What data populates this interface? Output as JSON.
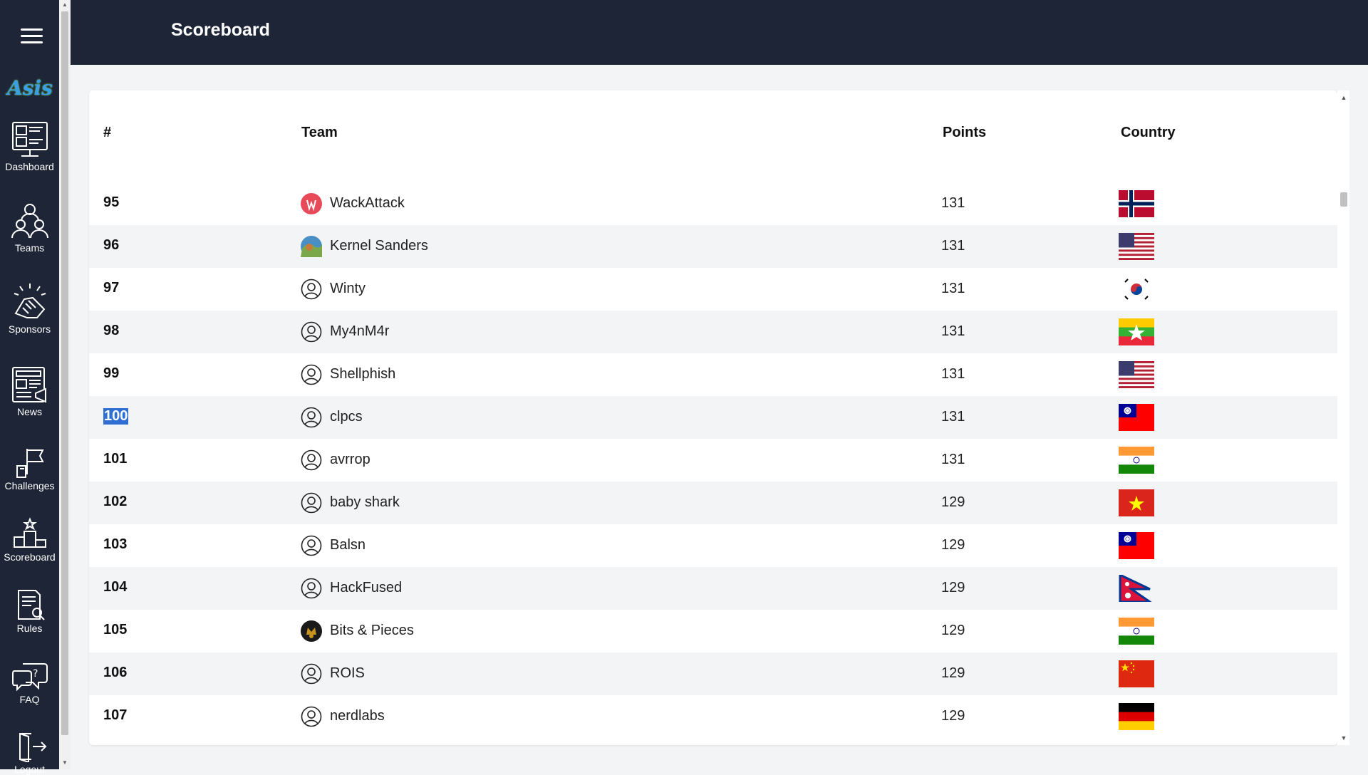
{
  "header": {
    "title": "Scoreboard"
  },
  "sidebar": {
    "logo": "Asis",
    "items": [
      {
        "label": "Dashboard"
      },
      {
        "label": "Teams"
      },
      {
        "label": "Sponsors"
      },
      {
        "label": "News"
      },
      {
        "label": "Challenges"
      },
      {
        "label": "Scoreboard"
      },
      {
        "label": "Rules"
      },
      {
        "label": "FAQ"
      },
      {
        "label": "Logout"
      }
    ]
  },
  "table": {
    "columns": {
      "rank": "#",
      "team": "Team",
      "points": "Points",
      "country": "Country"
    },
    "rows": [
      {
        "rank": "95",
        "team": "WackAttack",
        "points": "131",
        "country": "Norway",
        "avatar": "wackattack-logo"
      },
      {
        "rank": "96",
        "team": "Kernel Sanders",
        "points": "131",
        "country": "United States",
        "avatar": "kernel-sanders-logo"
      },
      {
        "rank": "97",
        "team": "Winty",
        "points": "131",
        "country": "South Korea",
        "avatar": "user-icon"
      },
      {
        "rank": "98",
        "team": "My4nM4r",
        "points": "131",
        "country": "Myanmar",
        "avatar": "user-icon"
      },
      {
        "rank": "99",
        "team": "Shellphish",
        "points": "131",
        "country": "United States",
        "avatar": "user-icon"
      },
      {
        "rank": "100",
        "team": "clpcs",
        "points": "131",
        "country": "Taiwan",
        "avatar": "user-icon",
        "selected": true
      },
      {
        "rank": "101",
        "team": "avrrop",
        "points": "131",
        "country": "India",
        "avatar": "user-icon"
      },
      {
        "rank": "102",
        "team": "baby shark",
        "points": "129",
        "country": "Vietnam",
        "avatar": "user-icon"
      },
      {
        "rank": "103",
        "team": "Balsn",
        "points": "129",
        "country": "Taiwan",
        "avatar": "user-icon"
      },
      {
        "rank": "104",
        "team": "HackFused",
        "points": "129",
        "country": "Nepal",
        "avatar": "user-icon"
      },
      {
        "rank": "105",
        "team": "Bits & Pieces",
        "points": "129",
        "country": "India",
        "avatar": "bits-pieces-logo"
      },
      {
        "rank": "106",
        "team": "ROIS",
        "points": "129",
        "country": "China",
        "avatar": "user-icon"
      },
      {
        "rank": "107",
        "team": "nerdlabs",
        "points": "129",
        "country": "Germany",
        "avatar": "user-icon"
      }
    ]
  },
  "colors": {
    "sidebar": "#1e2536",
    "header": "#1e2536",
    "row_alt": "#f3f4f6",
    "selection": "#2f6fd1"
  }
}
